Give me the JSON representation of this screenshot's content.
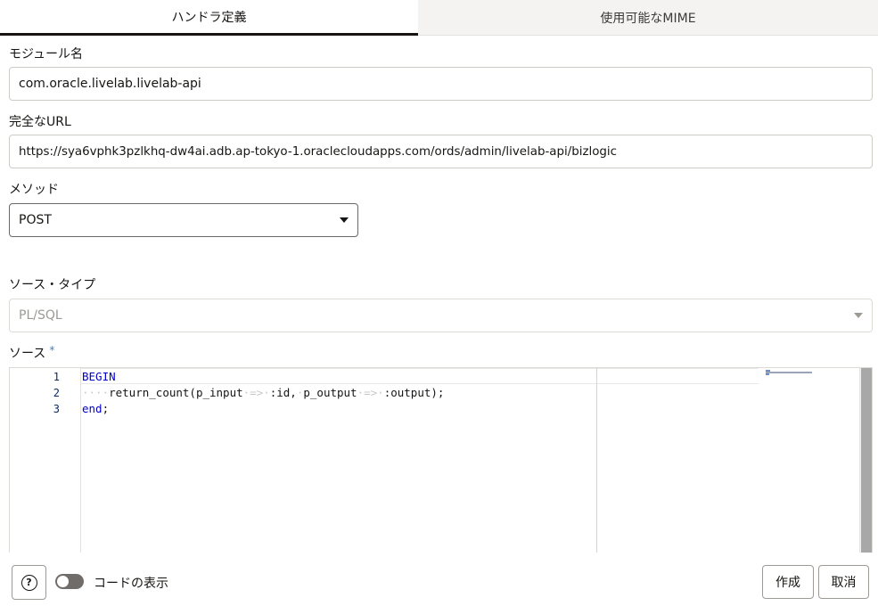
{
  "tabs": [
    {
      "label": "ハンドラ定義",
      "active": true
    },
    {
      "label": "使用可能なMIME",
      "active": false
    }
  ],
  "module": {
    "label": "モジュール名",
    "value": "com.oracle.livelab.livelab-api"
  },
  "full_url": {
    "label": "完全なURL",
    "value": "https://sya6vphk3pzlkhq-dw4ai.adb.ap-tokyo-1.oraclecloudapps.com/ords/admin/livelab-api/bizlogic"
  },
  "method": {
    "label": "メソッド",
    "value": "POST"
  },
  "source_type": {
    "label": "ソース・タイプ",
    "value": "PL/SQL"
  },
  "source": {
    "label": "ソース",
    "required_mark": "*",
    "line_numbers": [
      "1",
      "2",
      "3"
    ],
    "lines": {
      "l1_kw": "BEGIN",
      "l2_indent": "····",
      "l2_a": "return_count(p_input",
      "l2_arrow1": "·=>·",
      "l2_b": ":id,",
      "l2_sp": "·",
      "l2_c": "p_output",
      "l2_arrow2": "·=>·",
      "l2_d": ":output);",
      "l3_kw": "end",
      "l3_rest": ";"
    }
  },
  "footer": {
    "help_icon": "question-mark-icon",
    "help_glyph": "?",
    "toggle_label": "コードの表示",
    "toggle_on": false,
    "create_label": "作成",
    "cancel_label": "取消"
  },
  "colors": {
    "keyword": "#0000cc",
    "line_number": "#0a2a66",
    "required": "#5a7aa8",
    "tab_active_border": "#161513"
  }
}
